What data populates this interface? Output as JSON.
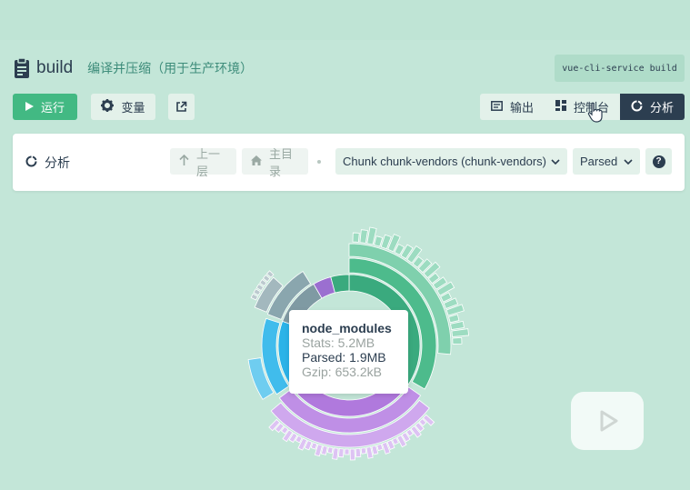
{
  "header": {
    "title": "build",
    "subtitle": "编译并压缩（用于生产环境）",
    "command": "vue-cli-service build"
  },
  "toolbar": {
    "run_label": "运行",
    "variables_label": "变量"
  },
  "tabs": [
    {
      "label": "输出",
      "icon": "output-icon"
    },
    {
      "label": "控制台",
      "icon": "dashboard-icon"
    },
    {
      "label": "分析",
      "icon": "analyze-icon",
      "active": true
    }
  ],
  "panel": {
    "title": "分析",
    "up_label": "上一层",
    "home_label": "主目录",
    "chunk_select": "Chunk chunk-vendors (chunk-vendors)",
    "size_select": "Parsed",
    "help": "?"
  },
  "tooltip": {
    "name": "node_modules",
    "stats": "Stats: 5.2MB",
    "parsed": "Parsed: 1.9MB",
    "gzip": "Gzip: 653.2kB"
  },
  "colors": {
    "accent": "#42b983",
    "dark": "#2c3e50",
    "green": "#3aaa7e",
    "purple": "#b079dd",
    "blue": "#2bb3e8",
    "gray": "#7f9aa3"
  }
}
